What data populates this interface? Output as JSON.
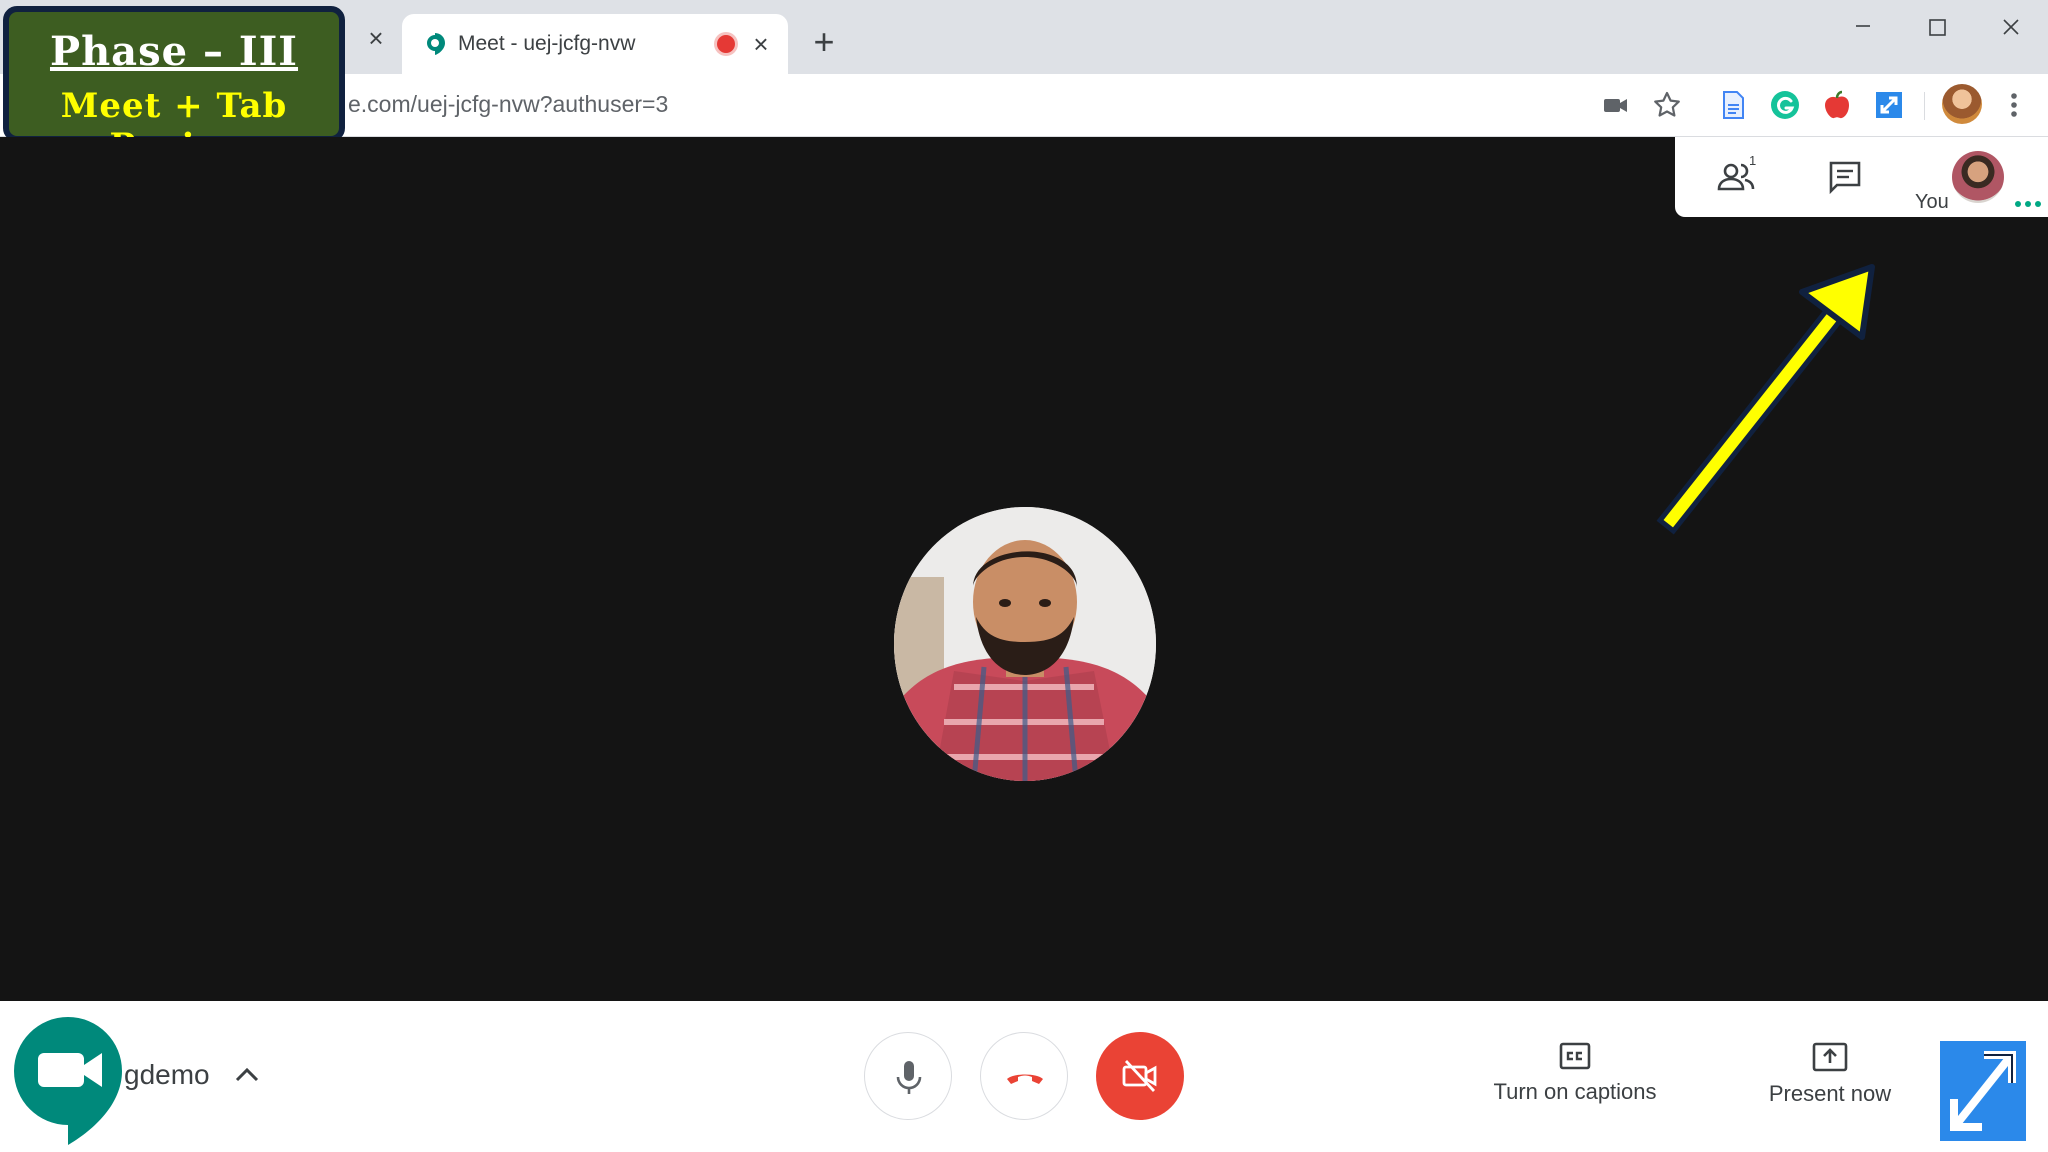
{
  "overlay": {
    "title": "Phase – III",
    "subtitle": "Meet + Tab Resize"
  },
  "browser": {
    "tab": {
      "title": "Meet - uej-jcfg-nvw",
      "close_label": "×"
    },
    "prev_tab_close_label": "×",
    "new_tab_label": "+",
    "url": "e.com/uej-jcfg-nvw?authuser=3"
  },
  "meet": {
    "self_label": "You",
    "participant_count": "1",
    "meeting_name": "gdemo",
    "captions_label": "Turn on captions",
    "present_label": "Present now"
  },
  "colors": {
    "hangup": "#ea4335",
    "meet_green": "#00897b",
    "annotation_arrow": "#ffff00",
    "overlay_bg": "#3d5d21",
    "resize_extension": "#2b89ea"
  }
}
